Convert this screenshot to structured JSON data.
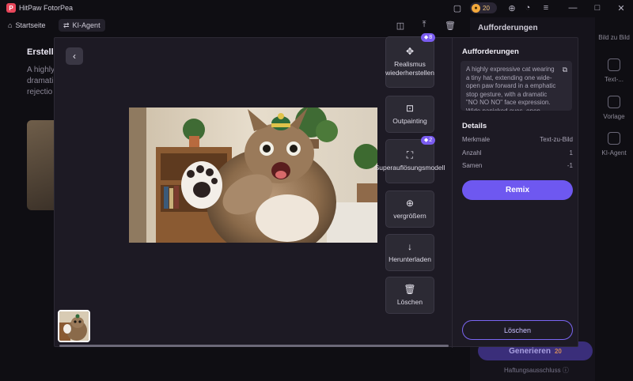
{
  "app": {
    "title": "HitPaw FotorPea",
    "coins": "20"
  },
  "nav": {
    "home": "Startseite",
    "agent": "KI-Agent"
  },
  "background": {
    "heading": "Erstellu",
    "text": "A highly dramati rejectio",
    "panel_title": "Aufforderungen",
    "rail": [
      "Bild zu Bild",
      "Text-...",
      "Vorlage",
      "KI-Agent"
    ],
    "generate_label": "Generieren",
    "generate_cost": "20",
    "disclaimer": "Haftungsausschluss"
  },
  "modal": {
    "tools": [
      {
        "label": "Realismus wiederherstellen",
        "icon": "restore-icon",
        "badge": "8"
      },
      {
        "label": "Outpainting",
        "icon": "outpainting-icon",
        "badge": ""
      },
      {
        "label": "Superauflösungsmodell",
        "icon": "superresolution-icon",
        "badge": "2"
      },
      {
        "label": "vergrößern",
        "icon": "zoom-icon",
        "badge": ""
      },
      {
        "label": "Herunterladen",
        "icon": "download-icon",
        "badge": ""
      },
      {
        "label": "Löschen",
        "icon": "trash-icon",
        "badge": ""
      }
    ],
    "details": {
      "prompts_heading": "Aufforderungen",
      "prompt_text": "A highly expressive cat wearing a tiny hat, extending one wide-open paw forward in a emphatic stop gesture, with a dramatic \"NO NO NO\" face expression. Wide panicked eyes, open mouth mid-",
      "details_heading": "Details",
      "rows": [
        {
          "label": "Merkmale",
          "value": "Text-zu-Bild"
        },
        {
          "label": "Anzahl",
          "value": "1"
        },
        {
          "label": "Samen",
          "value": "-1"
        }
      ],
      "remix_label": "Remix",
      "delete_label": "Löschen"
    }
  },
  "colors": {
    "accent": "#6e58f0",
    "badge": "#7a5cf0",
    "modal_bg": "#1d1a24"
  }
}
